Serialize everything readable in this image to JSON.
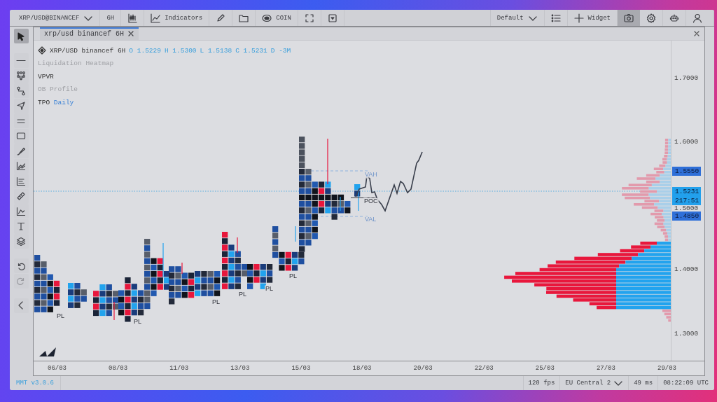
{
  "toolbar": {
    "symbol": "XRP/USD@BINANCEF",
    "interval": "6H",
    "indicators_label": "Indicators",
    "coin_label": "COIN",
    "layout_name": "Default",
    "widget_label": "Widget",
    "snapshot_selected": true
  },
  "tool_groups": [
    {
      "tools": [
        {
          "kind": "cursor",
          "selected": true,
          "disabled": false
        }
      ]
    },
    {
      "tools": [
        {
          "kind": "line",
          "selected": false,
          "disabled": false
        },
        {
          "kind": "nodes",
          "selected": false,
          "disabled": false
        },
        {
          "kind": "path",
          "selected": false,
          "disabled": false
        },
        {
          "kind": "arrow",
          "selected": false,
          "disabled": false
        },
        {
          "kind": "parallel",
          "selected": false,
          "disabled": false
        },
        {
          "kind": "rectangle",
          "selected": false,
          "disabled": false
        },
        {
          "kind": "brush",
          "selected": false,
          "disabled": false
        },
        {
          "kind": "trend",
          "selected": false,
          "disabled": false
        },
        {
          "kind": "levels",
          "selected": false,
          "disabled": false
        },
        {
          "kind": "ruler",
          "selected": false,
          "disabled": false
        },
        {
          "kind": "area",
          "selected": false,
          "disabled": false
        },
        {
          "kind": "text",
          "selected": false,
          "disabled": false
        },
        {
          "kind": "layers",
          "selected": false,
          "disabled": false
        }
      ]
    },
    {
      "tools": [
        {
          "kind": "undo",
          "selected": false,
          "disabled": false
        },
        {
          "kind": "redo",
          "selected": false,
          "disabled": true
        }
      ]
    },
    {
      "tools": [
        {
          "kind": "collapse",
          "selected": false,
          "disabled": false
        }
      ]
    }
  ],
  "chart_tab": {
    "title": "xrp/usd binancef 6H",
    "selected": true
  },
  "legend": {
    "title": "XRP/USD binancef 6H",
    "ohlc": [
      {
        "label": "O",
        "value": "1.5229"
      },
      {
        "label": "H",
        "value": "1.5300"
      },
      {
        "label": "L",
        "value": "1.5138"
      },
      {
        "label": "C",
        "value": "1.5231"
      },
      {
        "label": "D",
        "value": "-3M"
      }
    ],
    "indicators": [
      {
        "name": "Liquidation Heatmap",
        "hidden": true
      },
      {
        "name": "VPVR",
        "hidden": false
      },
      {
        "name": "OB Profile",
        "hidden": true
      },
      {
        "name": "TPO",
        "param": "Daily",
        "hidden": false
      }
    ]
  },
  "tpo_labels": [
    {
      "text": "VAH",
      "kind": "value_area"
    },
    {
      "text": "POC",
      "kind": "poc"
    },
    {
      "text": "VAL",
      "kind": "value_area"
    },
    {
      "text": "PL",
      "kind": "low"
    },
    {
      "text": "PL",
      "kind": "low"
    },
    {
      "text": "PL",
      "kind": "low"
    },
    {
      "text": "PL",
      "kind": "low"
    },
    {
      "text": "PL",
      "kind": "low"
    },
    {
      "text": "PL",
      "kind": "low"
    }
  ],
  "price_ticks": [
    "1.7000",
    "1.6000",
    "1.5000",
    "1.4000",
    "1.3000"
  ],
  "price_badges": [
    {
      "text": "1.5550",
      "color": "#2f6fd8"
    },
    {
      "text": "1.5231",
      "color": "#22a0ec"
    },
    {
      "text": "217:51",
      "color": "#22a0ec"
    },
    {
      "text": "1.4850",
      "color": "#2f6fd8"
    }
  ],
  "time_ticks": [
    "06/03",
    "08/03",
    "11/03",
    "13/03",
    "15/03",
    "18/03",
    "20/03",
    "22/03",
    "25/03",
    "27/03",
    "29/03"
  ],
  "status_bar": {
    "version": "MMT v3.0.6",
    "fps": "120 fps",
    "region": "EU Central 2",
    "latency": "49 ms",
    "clock": "08:22:09 UTC"
  }
}
